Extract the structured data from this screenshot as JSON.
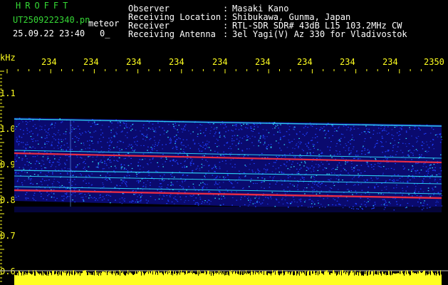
{
  "header": {
    "title": "HROFFT",
    "filename": "UT2509222340.pn",
    "meteor_label": "meteor",
    "datetime": "25.09.22 23:40",
    "count": "0_"
  },
  "meta": [
    {
      "key": "Observer",
      "value": "Masaki Kano"
    },
    {
      "key": "Receiving Location",
      "value": "Shibukawa, Gunma, Japan"
    },
    {
      "key": "Receiver",
      "value": "RTL-SDR SDR# 43dB L15 103.2MHz CW"
    },
    {
      "key": "Receiving Antenna",
      "value": "3el Yagi(V) Az 330 for Vladivostok"
    }
  ],
  "axes": {
    "y_unit": "kHz",
    "y_ticks": [
      "1.1",
      "1.0",
      "0.9",
      "0.8",
      "0.7",
      "0.6"
    ],
    "x_ticks": [
      "234",
      "234",
      "234",
      "234",
      "234",
      "234",
      "234",
      "234",
      "234",
      "2350"
    ]
  },
  "colors": {
    "label_green": "#35d835",
    "axis_yellow": "#ffff20",
    "spectro_bg": "#000000",
    "noise_dark": "#0a0a6e",
    "noise_blue": "#2040ff",
    "noise_cyan": "#30e0ff",
    "trace_red": "#ff3040"
  }
}
